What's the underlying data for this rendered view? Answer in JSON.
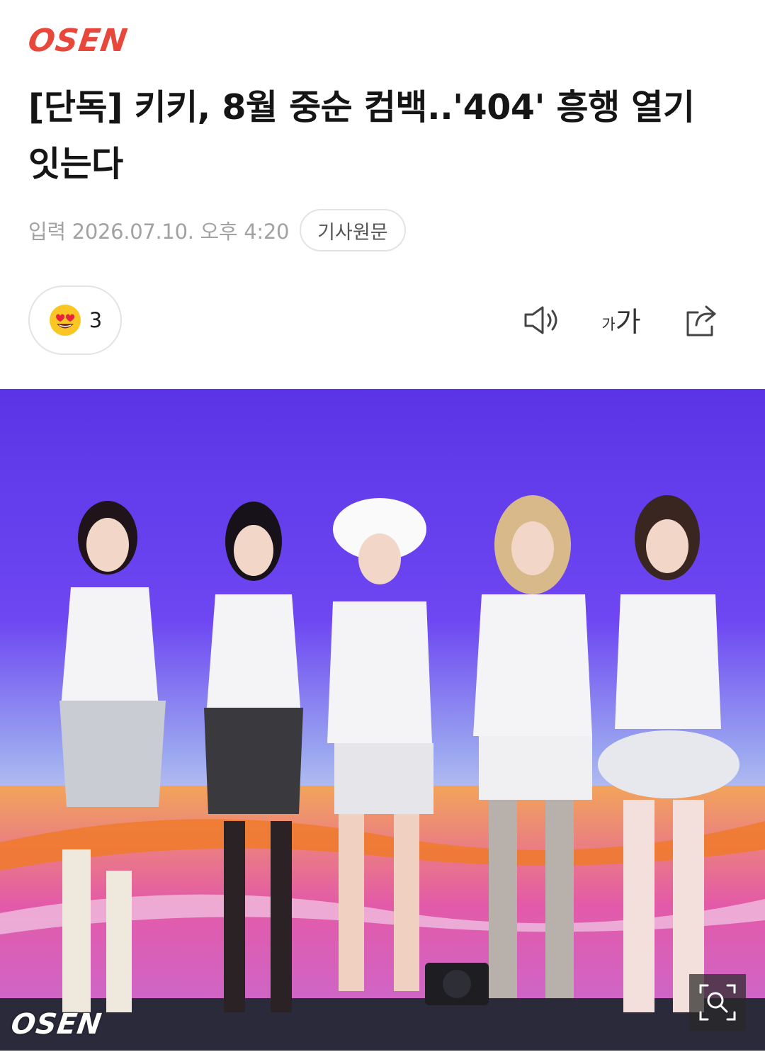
{
  "brand": {
    "logo_text": "OSEN",
    "logo_color": "#e8483b"
  },
  "article": {
    "headline": "[단독] 키키, 8월 중순 컴백..'404' 흥행 열기 잇는다",
    "input_label": "입력 2026.07.10. 오후 4:20",
    "source_button": "기사원문"
  },
  "reaction": {
    "emoji": "heart-eyes-emoji",
    "count": "3"
  },
  "toolbar": {
    "audio_icon": "speaker-icon",
    "font_small": "가",
    "font_large": "가",
    "share_icon": "share-icon"
  },
  "photo": {
    "watermark": "OSEN",
    "zoom_icon": "zoom-icon",
    "colors": {
      "stage_wall": "#6b3ff0",
      "stage_floor": "#e8782a"
    }
  }
}
